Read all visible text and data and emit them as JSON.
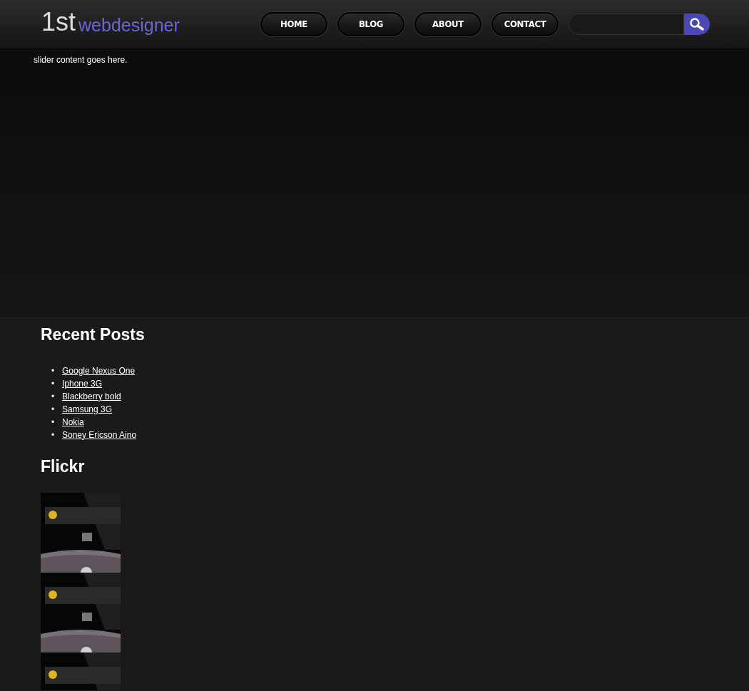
{
  "logo": {
    "prefix": "1st",
    "name": "webdesigner"
  },
  "nav": [
    {
      "label": "HOME"
    },
    {
      "label": "BLOG"
    },
    {
      "label": "ABOUT"
    },
    {
      "label": "CONTACT"
    }
  ],
  "slider": {
    "text": "slider content goes here."
  },
  "recent_posts": {
    "title": "Recent Posts",
    "items": [
      {
        "marker": "•",
        "label": "Google Nexus One"
      },
      {
        "marker": "•",
        "label": "Iphone 3G"
      },
      {
        "marker": "•",
        "label": "Blackberry bold"
      },
      {
        "marker": "•",
        "label": "Samsung 3G"
      },
      {
        "marker": "•",
        "label": "Nokia"
      },
      {
        "marker": "•",
        "label": "Soney Ericson Aino"
      }
    ]
  },
  "flickr": {
    "title": "Flickr"
  }
}
